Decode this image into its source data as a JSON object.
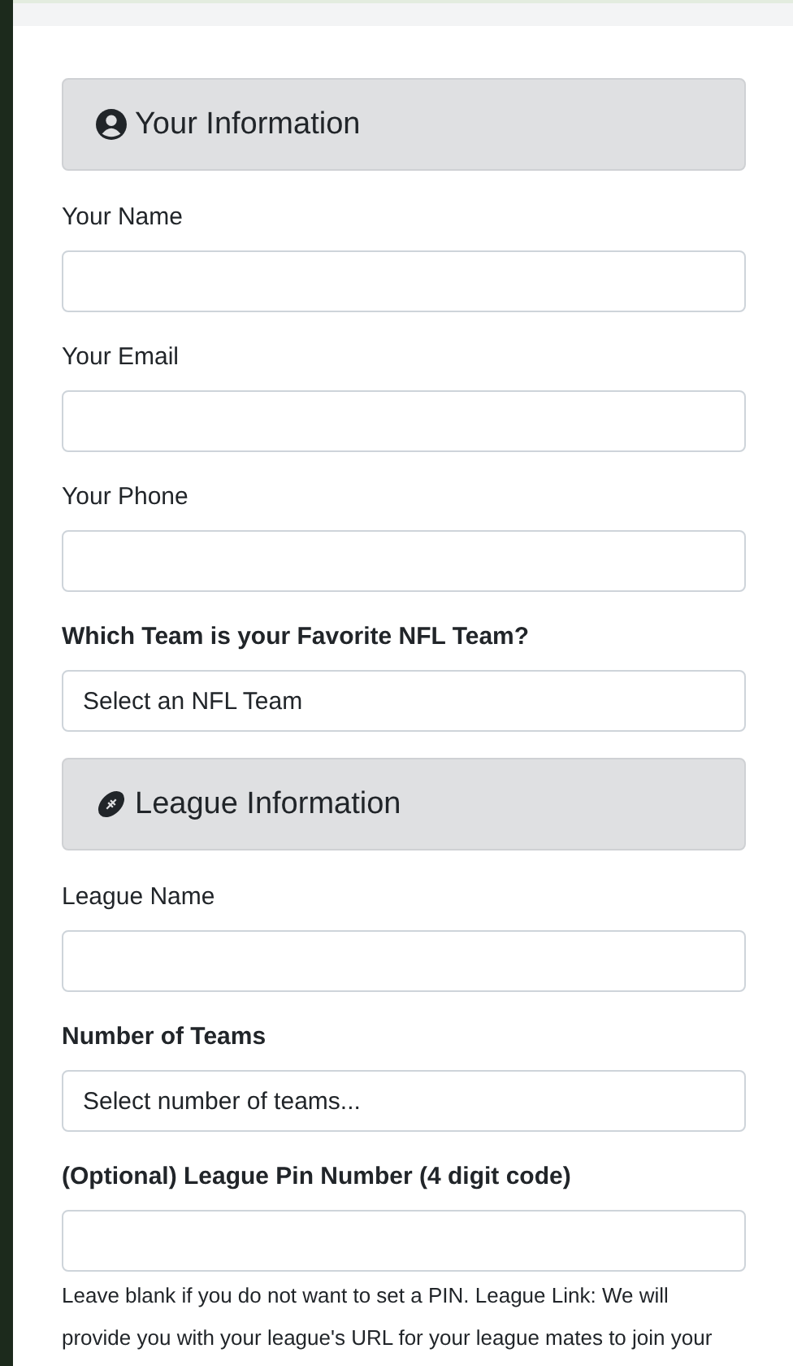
{
  "sections": [
    {
      "title": "Your Information",
      "fields": [
        {
          "label": "Your Name",
          "kind": "text",
          "bold": false
        },
        {
          "label": "Your Email",
          "kind": "text",
          "bold": false
        },
        {
          "label": "Your Phone",
          "kind": "text",
          "bold": false
        },
        {
          "label": "Which Team is your Favorite NFL Team?",
          "kind": "select",
          "bold": true,
          "placeholder": "Select an NFL Team"
        }
      ]
    },
    {
      "title": "League Information",
      "fields": [
        {
          "label": "League Name",
          "kind": "text",
          "bold": false
        },
        {
          "label": "Number of Teams",
          "kind": "select",
          "bold": true,
          "placeholder": "Select number of teams..."
        },
        {
          "label": "(Optional) League Pin Number (4 digit code)",
          "kind": "text",
          "bold": true,
          "help": "Leave blank if you do not want to set a PIN. League Link: We will provide you with your league's URL for your league mates to join your"
        }
      ]
    }
  ]
}
